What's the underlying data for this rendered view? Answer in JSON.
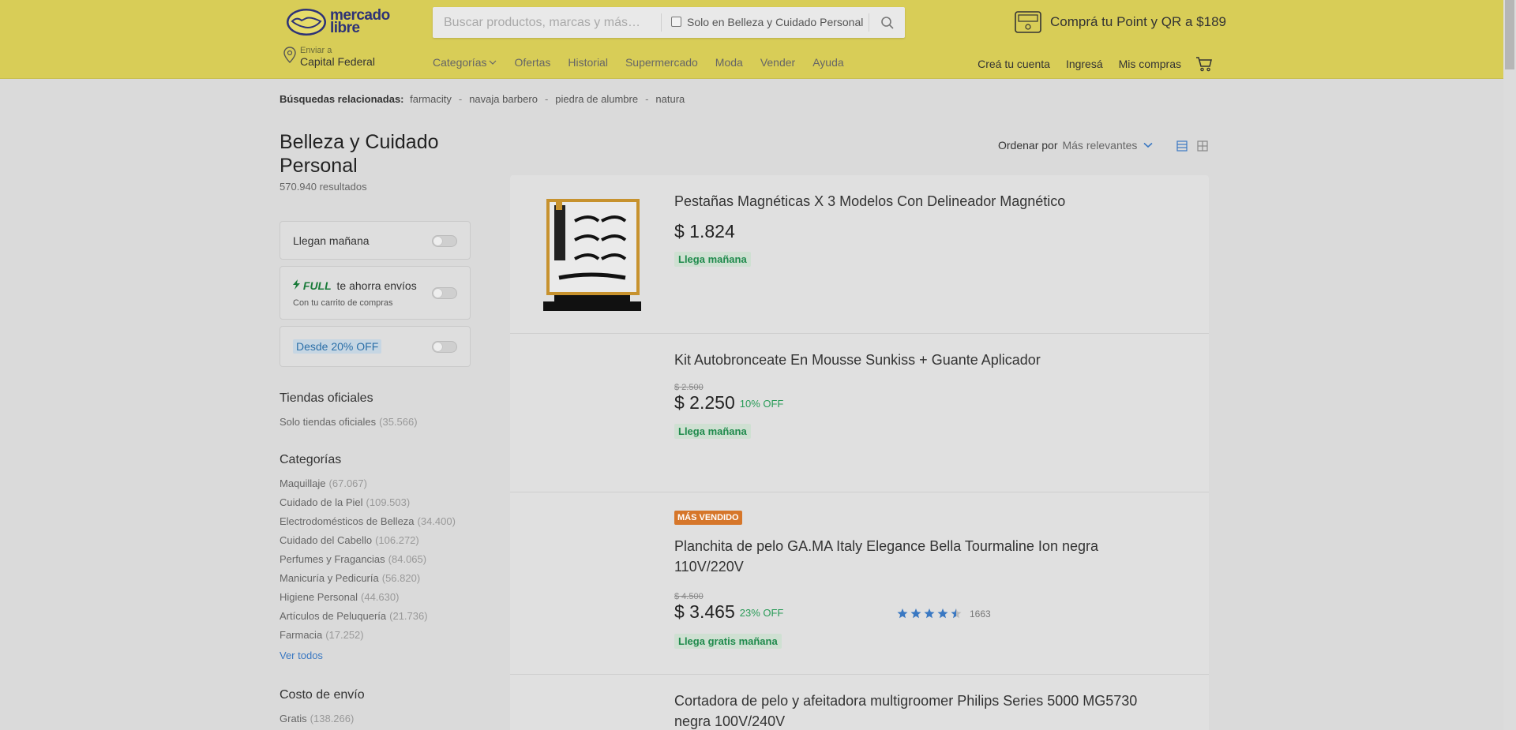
{
  "header": {
    "logo_line1": "mercado",
    "logo_line2": "libre",
    "search_placeholder": "Buscar productos, marcas y más…",
    "search_scope_label": "Solo en Belleza y Cuidado Personal",
    "promo_text": "Comprá tu Point y QR a $189",
    "location_small": "Enviar a",
    "location_big": "Capital Federal",
    "nav": [
      "Categorías",
      "Ofertas",
      "Historial",
      "Supermercado",
      "Moda",
      "Vender",
      "Ayuda"
    ],
    "account": [
      "Creá tu cuenta",
      "Ingresá",
      "Mis compras"
    ]
  },
  "related": {
    "label": "Búsquedas relacionadas:",
    "items": [
      "farmacity",
      "navaja barbero",
      "piedra de alumbre",
      "natura"
    ]
  },
  "page": {
    "title": "Belleza y Cuidado Personal",
    "results": "570.940 resultados"
  },
  "filters": {
    "tomorrow": "Llegan mañana",
    "full_word": "FULL",
    "full_text": "te ahorra envíos",
    "full_sub": "Con tu carrito de compras",
    "discount": "Desde 20% OFF"
  },
  "stores": {
    "title": "Tiendas oficiales",
    "item": "Solo tiendas oficiales",
    "count": "(35.566)"
  },
  "categories": {
    "title": "Categorías",
    "items": [
      {
        "name": "Maquillaje",
        "count": "(67.067)"
      },
      {
        "name": "Cuidado de la Piel",
        "count": "(109.503)"
      },
      {
        "name": "Electrodomésticos de Belleza",
        "count": "(34.400)"
      },
      {
        "name": "Cuidado del Cabello",
        "count": "(106.272)"
      },
      {
        "name": "Perfumes y Fragancias",
        "count": "(84.065)"
      },
      {
        "name": "Manicuría y Pedicuría",
        "count": "(56.820)"
      },
      {
        "name": "Higiene Personal",
        "count": "(44.630)"
      },
      {
        "name": "Artículos de Peluquería",
        "count": "(21.736)"
      },
      {
        "name": "Farmacia",
        "count": "(17.252)"
      }
    ],
    "see_all": "Ver todos"
  },
  "shipping": {
    "title": "Costo de envío",
    "item": "Gratis",
    "count": "(138.266)"
  },
  "sort": {
    "label": "Ordenar por",
    "value": "Más relevantes"
  },
  "products": [
    {
      "title": "Pestañas Magnéticas X 3 Modelos Con Delineador Magnético",
      "price": "$ 1.824",
      "shipping": "Llega mañana"
    },
    {
      "title": "Kit Autobronceate En Mousse Sunkiss + Guante Aplicador",
      "old_price": "$ 2.500",
      "price": "$ 2.250",
      "discount": "10% OFF",
      "shipping": "Llega mañana"
    },
    {
      "badge": "MÁS VENDIDO",
      "title": "Planchita de pelo GA.MA Italy Elegance Bella Tourmaline Ion negra 110V/220V",
      "old_price": "$ 4.500",
      "price": "$ 3.465",
      "discount": "23% OFF",
      "rating": 4.5,
      "reviews": "1663",
      "shipping": "Llega gratis mañana"
    },
    {
      "title": "Cortadora de pelo y afeitadora multigroomer Philips Series 5000 MG5730 negra 100V/240V"
    }
  ],
  "colors": {
    "header_bg": "#d8cd57",
    "page_bg": "#dadada",
    "ship_green": "#1f8a4c",
    "link_blue": "#3a78c2",
    "badge_orange": "#d6762a"
  }
}
